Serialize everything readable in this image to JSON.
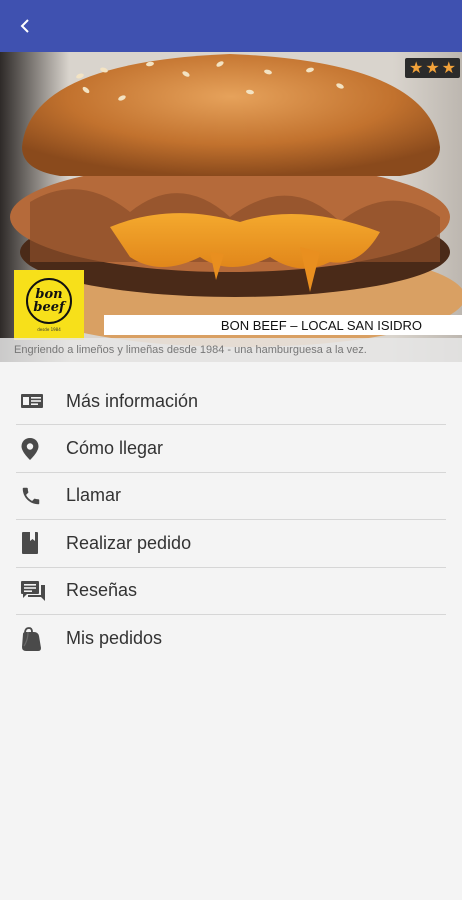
{
  "header": {
    "back_icon": "chevron-left-icon",
    "color": "#3f51b0"
  },
  "hero": {
    "rating_stars": 3,
    "star_color": "#f2a23a",
    "logo": {
      "text_line1": "bon",
      "text_line2": "beef",
      "sub": "desde 1984",
      "background": "#f7e01a"
    },
    "restaurant_name": "BON BEEF – LOCAL SAN ISIDRO",
    "tagline": "Engriendo a limeños y limeñas desde 1984 - una hamburguesa a la vez."
  },
  "menu": {
    "items": [
      {
        "label": "Más información",
        "icon": "info-card-icon"
      },
      {
        "label": "Cómo llegar",
        "icon": "location-pin-icon"
      },
      {
        "label": "Llamar",
        "icon": "phone-icon"
      },
      {
        "label": "Realizar pedido",
        "icon": "order-book-icon"
      },
      {
        "label": "Reseñas",
        "icon": "reviews-chat-icon"
      },
      {
        "label": "Mis pedidos",
        "icon": "shopping-bag-icon"
      }
    ]
  }
}
